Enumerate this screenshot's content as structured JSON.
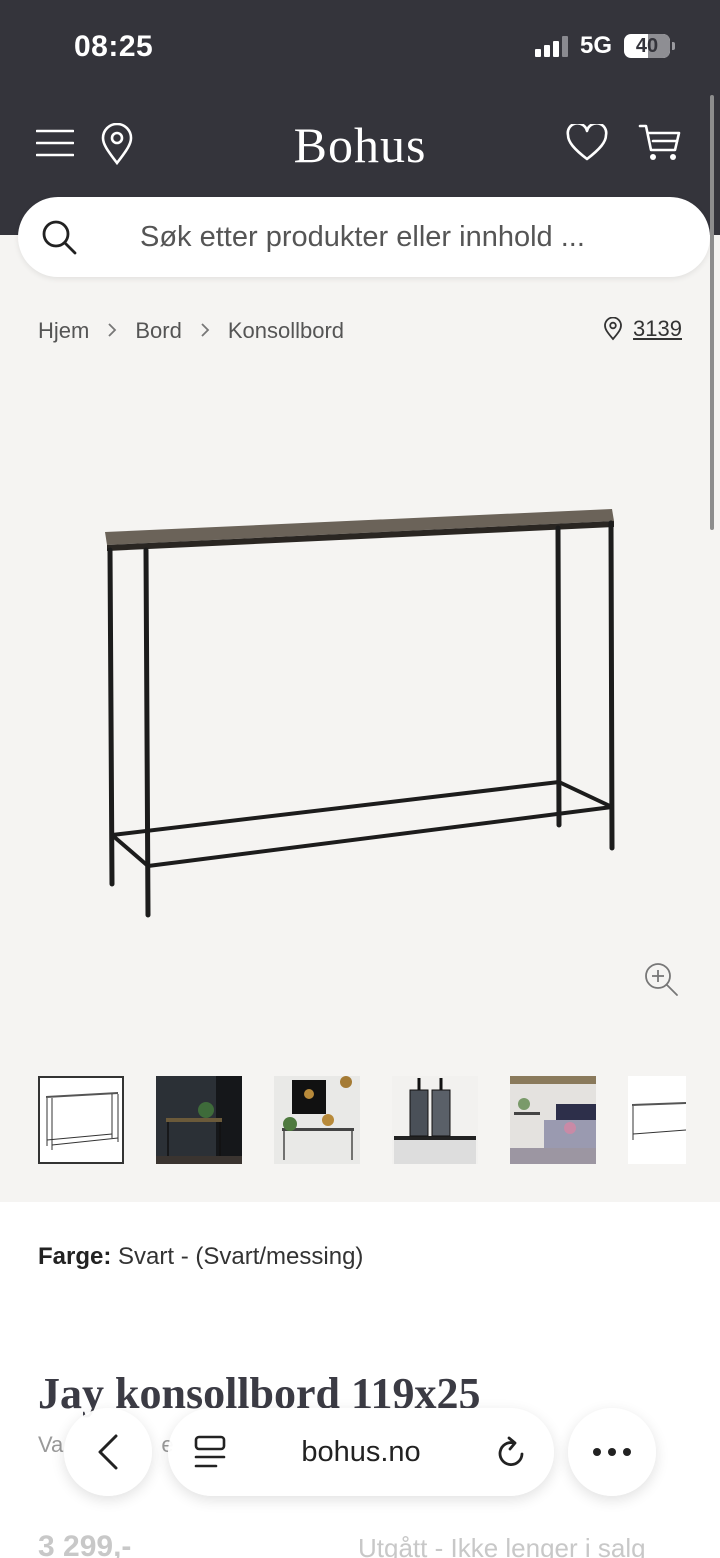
{
  "status": {
    "time": "08:25",
    "network": "5G",
    "battery": "40",
    "battery_level": 0.4
  },
  "header": {
    "logo": "Bohus",
    "icons": [
      "menu-icon",
      "location-pin-icon",
      "heart-icon",
      "cart-icon"
    ]
  },
  "search": {
    "placeholder": "Søk etter produkter eller innhold ..."
  },
  "breadcrumb": {
    "items": [
      "Hjem",
      "Bord",
      "Konsollbord"
    ],
    "separator": ">"
  },
  "store": {
    "number": "3139"
  },
  "product": {
    "color_label": "Farge:",
    "color_value": "Svart - (Svart/messing)",
    "title": "Jay konsollbord 119x25",
    "subtitle_partial": "Va",
    "subtitle_tail": "e",
    "price": "3 299,-",
    "availability": "Utgått - Ikke lenger i salg"
  },
  "gallery": {
    "thumbnail_count": 6,
    "active_index": 0
  },
  "browser": {
    "address": "bohus.no",
    "back_label": "back",
    "more_label": "more"
  },
  "colors": {
    "header_bg": "#34343b",
    "page_bg": "#f5f4f2"
  }
}
